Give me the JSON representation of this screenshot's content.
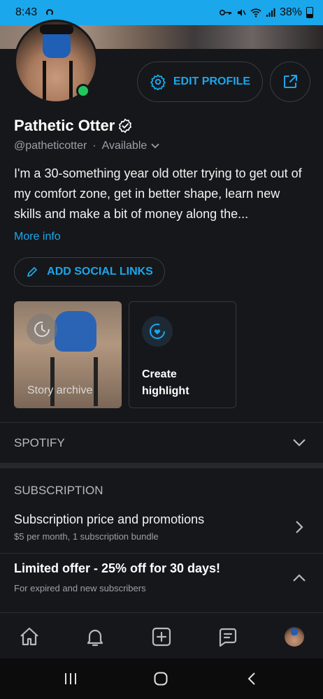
{
  "status_bar": {
    "time": "8:43",
    "battery": "38%"
  },
  "profile": {
    "name": "Pathetic Otter",
    "handle": "@patheticotter",
    "separator": "·",
    "availability": "Available",
    "bio": "I'm a 30-something year old otter trying to get out of my comfort zone, get in better shape, learn new skills and make a bit of money along the...",
    "more_info": "More info",
    "online": true
  },
  "buttons": {
    "edit_profile": "EDIT PROFILE",
    "add_social_links": "ADD SOCIAL LINKS"
  },
  "highlights": {
    "story_archive": "Story archive",
    "create_highlight_line1": "Create",
    "create_highlight_line2": "highlight"
  },
  "sections": {
    "spotify": "SPOTIFY",
    "subscription": "SUBSCRIPTION"
  },
  "subscription": {
    "price_title": "Subscription price and promotions",
    "price_sub": "$5 per month, 1 subscription bundle",
    "offer_title": "Limited offer - 25% off for 30 days!",
    "offer_sub": "For expired and new subscribers"
  },
  "colors": {
    "accent": "#1aa7ec",
    "background": "#16171a",
    "online": "#22c55e"
  },
  "icons": [
    "home-icon",
    "bell-icon",
    "add-post-icon",
    "messages-icon",
    "profile-avatar"
  ]
}
